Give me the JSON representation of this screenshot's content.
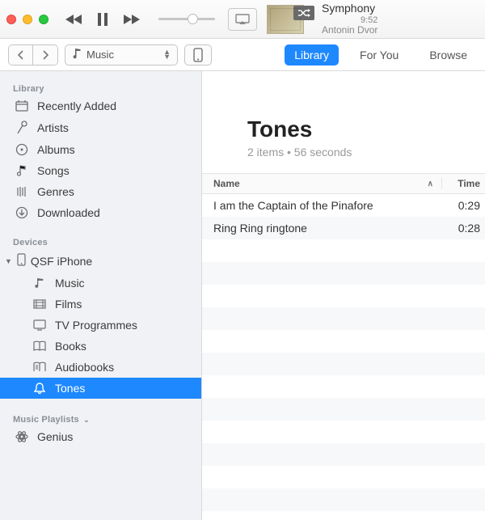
{
  "player": {
    "track_title": "Symphony",
    "time": "9:52",
    "artist": "Antonin Dvor"
  },
  "toolbar": {
    "media_label": "Music",
    "tabs": {
      "library": "Library",
      "for_you": "For You",
      "browse": "Browse"
    }
  },
  "sidebar": {
    "library_header": "Library",
    "library": [
      {
        "label": "Recently Added"
      },
      {
        "label": "Artists"
      },
      {
        "label": "Albums"
      },
      {
        "label": "Songs"
      },
      {
        "label": "Genres"
      },
      {
        "label": "Downloaded"
      }
    ],
    "devices_header": "Devices",
    "device_name": "QSF iPhone",
    "device_items": [
      {
        "label": "Music"
      },
      {
        "label": "Films"
      },
      {
        "label": "TV Programmes"
      },
      {
        "label": "Books"
      },
      {
        "label": "Audiobooks"
      },
      {
        "label": "Tones"
      }
    ],
    "playlists_header": "Music Playlists",
    "genius": "Genius"
  },
  "content": {
    "title": "Tones",
    "subtitle": "2 items • 56 seconds",
    "columns": {
      "name": "Name",
      "time": "Time"
    },
    "rows": [
      {
        "name": "I am the Captain of the Pinafore",
        "time": "0:29"
      },
      {
        "name": "Ring Ring ringtone",
        "time": "0:28"
      }
    ]
  }
}
